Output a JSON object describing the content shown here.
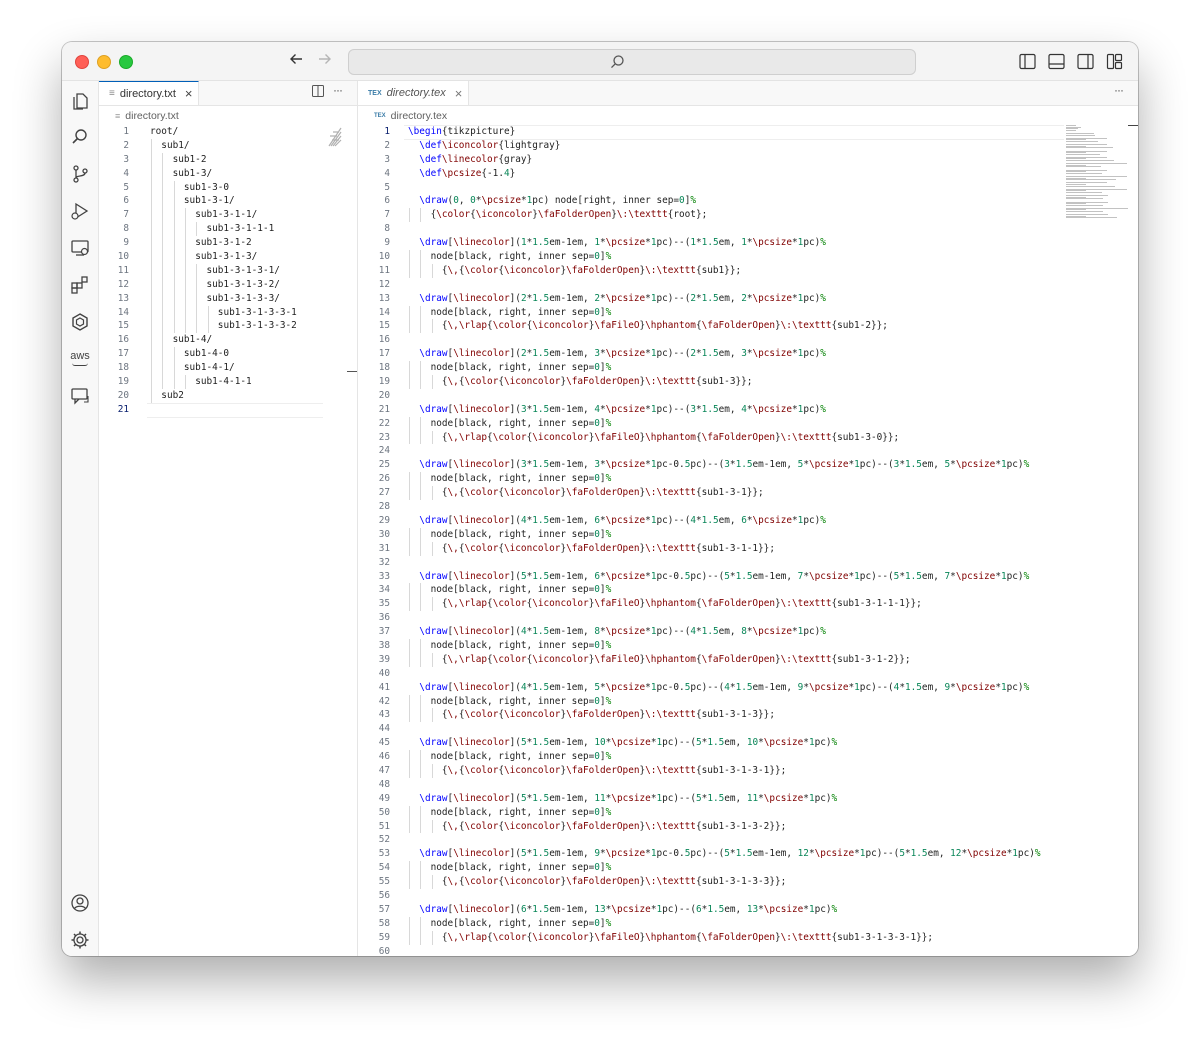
{
  "window": {
    "search_placeholder": "",
    "colors": {
      "accent": "#005fb8",
      "red": "#ff5f57",
      "yellow": "#febc2e",
      "green": "#28c840"
    }
  },
  "activity_bar": {
    "icons": [
      "explorer-icon",
      "search-icon",
      "source-control-icon",
      "run-debug-icon",
      "remote-explorer-icon",
      "extensions-icon",
      "hexagon-icon",
      "aws-icon",
      "chat-icon",
      "account-icon",
      "settings-gear-icon"
    ],
    "aws_label": "aws"
  },
  "left_editor": {
    "tab": {
      "name": "directory.txt",
      "close": "×"
    },
    "actions": [
      "split-editor-icon",
      "more-actions-icon"
    ],
    "more_label": "···",
    "breadcrumb": "directory.txt",
    "current_line": 21,
    "lines": [
      {
        "n": 1,
        "text": "root/"
      },
      {
        "n": 2,
        "text": "sub1/"
      },
      {
        "n": 3,
        "text": "sub1-2"
      },
      {
        "n": 4,
        "text": "sub1-3/"
      },
      {
        "n": 5,
        "text": "sub1-3-0"
      },
      {
        "n": 6,
        "text": "sub1-3-1/"
      },
      {
        "n": 7,
        "text": "sub1-3-1-1/"
      },
      {
        "n": 8,
        "text": "sub1-3-1-1-1"
      },
      {
        "n": 9,
        "text": "sub1-3-1-2"
      },
      {
        "n": 10,
        "text": "sub1-3-1-3/"
      },
      {
        "n": 11,
        "text": "sub1-3-1-3-1/"
      },
      {
        "n": 12,
        "text": "sub1-3-1-3-2/"
      },
      {
        "n": 13,
        "text": "sub1-3-1-3-3/"
      },
      {
        "n": 14,
        "text": "sub1-3-1-3-3-1"
      },
      {
        "n": 15,
        "text": "sub1-3-1-3-3-2"
      },
      {
        "n": 16,
        "text": "sub1-4/"
      },
      {
        "n": 17,
        "text": "sub1-4-0"
      },
      {
        "n": 18,
        "text": "sub1-4-1/"
      },
      {
        "n": 19,
        "text": "sub1-4-1-1"
      },
      {
        "n": 20,
        "text": "sub2"
      },
      {
        "n": 21,
        "text": ""
      }
    ]
  },
  "right_editor": {
    "tab": {
      "name": "directory.tex",
      "icon_label": "TEX",
      "close": "×"
    },
    "more_label": "···",
    "breadcrumb": "directory.tex",
    "current_line": 1,
    "lines": [
      {
        "n": 1,
        "text": "\\begin{tikzpicture}"
      },
      {
        "n": 2,
        "text": "  \\def\\iconcolor{lightgray}"
      },
      {
        "n": 3,
        "text": "  \\def\\linecolor{gray}"
      },
      {
        "n": 4,
        "text": "  \\def\\pcsize{-1.4}"
      },
      {
        "n": 5,
        "text": ""
      },
      {
        "n": 6,
        "text": "  \\draw(0, 0*\\pcsize*1pc) node[right, inner sep=0]%"
      },
      {
        "n": 7,
        "text": "    {\\color{\\iconcolor}\\faFolderOpen}\\:\\texttt{root};"
      },
      {
        "n": 8,
        "text": ""
      },
      {
        "n": 9,
        "text": "  \\draw[\\linecolor](1*1.5em-1em, 1*\\pcsize*1pc)--(1*1.5em, 1*\\pcsize*1pc)%"
      },
      {
        "n": 10,
        "text": "    node[black, right, inner sep=0]%"
      },
      {
        "n": 11,
        "text": "      {\\,{\\color{\\iconcolor}\\faFolderOpen}\\:\\texttt{sub1}};"
      },
      {
        "n": 12,
        "text": ""
      },
      {
        "n": 13,
        "text": "  \\draw[\\linecolor](2*1.5em-1em, 2*\\pcsize*1pc)--(2*1.5em, 2*\\pcsize*1pc)%"
      },
      {
        "n": 14,
        "text": "    node[black, right, inner sep=0]%"
      },
      {
        "n": 15,
        "text": "      {\\,\\rlap{\\color{\\iconcolor}\\faFileO}\\hphantom{\\faFolderOpen}\\:\\texttt{sub1-2}};"
      },
      {
        "n": 16,
        "text": ""
      },
      {
        "n": 17,
        "text": "  \\draw[\\linecolor](2*1.5em-1em, 3*\\pcsize*1pc)--(2*1.5em, 3*\\pcsize*1pc)%"
      },
      {
        "n": 18,
        "text": "    node[black, right, inner sep=0]%"
      },
      {
        "n": 19,
        "text": "      {\\,{\\color{\\iconcolor}\\faFolderOpen}\\:\\texttt{sub1-3}};"
      },
      {
        "n": 20,
        "text": ""
      },
      {
        "n": 21,
        "text": "  \\draw[\\linecolor](3*1.5em-1em, 4*\\pcsize*1pc)--(3*1.5em, 4*\\pcsize*1pc)%"
      },
      {
        "n": 22,
        "text": "    node[black, right, inner sep=0]%"
      },
      {
        "n": 23,
        "text": "      {\\,\\rlap{\\color{\\iconcolor}\\faFileO}\\hphantom{\\faFolderOpen}\\:\\texttt{sub1-3-0}};"
      },
      {
        "n": 24,
        "text": ""
      },
      {
        "n": 25,
        "text": "  \\draw[\\linecolor](3*1.5em-1em, 3*\\pcsize*1pc-0.5pc)--(3*1.5em-1em, 5*\\pcsize*1pc)--(3*1.5em, 5*\\pcsize*1pc)%"
      },
      {
        "n": 26,
        "text": "    node[black, right, inner sep=0]%"
      },
      {
        "n": 27,
        "text": "      {\\,{\\color{\\iconcolor}\\faFolderOpen}\\:\\texttt{sub1-3-1}};"
      },
      {
        "n": 28,
        "text": ""
      },
      {
        "n": 29,
        "text": "  \\draw[\\linecolor](4*1.5em-1em, 6*\\pcsize*1pc)--(4*1.5em, 6*\\pcsize*1pc)%"
      },
      {
        "n": 30,
        "text": "    node[black, right, inner sep=0]%"
      },
      {
        "n": 31,
        "text": "      {\\,{\\color{\\iconcolor}\\faFolderOpen}\\:\\texttt{sub1-3-1-1}};"
      },
      {
        "n": 32,
        "text": ""
      },
      {
        "n": 33,
        "text": "  \\draw[\\linecolor](5*1.5em-1em, 6*\\pcsize*1pc-0.5pc)--(5*1.5em-1em, 7*\\pcsize*1pc)--(5*1.5em, 7*\\pcsize*1pc)%"
      },
      {
        "n": 34,
        "text": "    node[black, right, inner sep=0]%"
      },
      {
        "n": 35,
        "text": "      {\\,\\rlap{\\color{\\iconcolor}\\faFileO}\\hphantom{\\faFolderOpen}\\:\\texttt{sub1-3-1-1-1}};"
      },
      {
        "n": 36,
        "text": ""
      },
      {
        "n": 37,
        "text": "  \\draw[\\linecolor](4*1.5em-1em, 8*\\pcsize*1pc)--(4*1.5em, 8*\\pcsize*1pc)%"
      },
      {
        "n": 38,
        "text": "    node[black, right, inner sep=0]%"
      },
      {
        "n": 39,
        "text": "      {\\,\\rlap{\\color{\\iconcolor}\\faFileO}\\hphantom{\\faFolderOpen}\\:\\texttt{sub1-3-1-2}};"
      },
      {
        "n": 40,
        "text": ""
      },
      {
        "n": 41,
        "text": "  \\draw[\\linecolor](4*1.5em-1em, 5*\\pcsize*1pc-0.5pc)--(4*1.5em-1em, 9*\\pcsize*1pc)--(4*1.5em, 9*\\pcsize*1pc)%"
      },
      {
        "n": 42,
        "text": "    node[black, right, inner sep=0]%"
      },
      {
        "n": 43,
        "text": "      {\\,{\\color{\\iconcolor}\\faFolderOpen}\\:\\texttt{sub1-3-1-3}};"
      },
      {
        "n": 44,
        "text": ""
      },
      {
        "n": 45,
        "text": "  \\draw[\\linecolor](5*1.5em-1em, 10*\\pcsize*1pc)--(5*1.5em, 10*\\pcsize*1pc)%"
      },
      {
        "n": 46,
        "text": "    node[black, right, inner sep=0]%"
      },
      {
        "n": 47,
        "text": "      {\\,{\\color{\\iconcolor}\\faFolderOpen}\\:\\texttt{sub1-3-1-3-1}};"
      },
      {
        "n": 48,
        "text": ""
      },
      {
        "n": 49,
        "text": "  \\draw[\\linecolor](5*1.5em-1em, 11*\\pcsize*1pc)--(5*1.5em, 11*\\pcsize*1pc)%"
      },
      {
        "n": 50,
        "text": "    node[black, right, inner sep=0]%"
      },
      {
        "n": 51,
        "text": "      {\\,{\\color{\\iconcolor}\\faFolderOpen}\\:\\texttt{sub1-3-1-3-2}};"
      },
      {
        "n": 52,
        "text": ""
      },
      {
        "n": 53,
        "text": "  \\draw[\\linecolor](5*1.5em-1em, 9*\\pcsize*1pc-0.5pc)--(5*1.5em-1em, 12*\\pcsize*1pc)--(5*1.5em, 12*\\pcsize*1pc)%"
      },
      {
        "n": 54,
        "text": "    node[black, right, inner sep=0]%"
      },
      {
        "n": 55,
        "text": "      {\\,{\\color{\\iconcolor}\\faFolderOpen}\\:\\texttt{sub1-3-1-3-3}};"
      },
      {
        "n": 56,
        "text": ""
      },
      {
        "n": 57,
        "text": "  \\draw[\\linecolor](6*1.5em-1em, 13*\\pcsize*1pc)--(6*1.5em, 13*\\pcsize*1pc)%"
      },
      {
        "n": 58,
        "text": "    node[black, right, inner sep=0]%"
      },
      {
        "n": 59,
        "text": "      {\\,\\rlap{\\color{\\iconcolor}\\faFileO}\\hphantom{\\faFolderOpen}\\:\\texttt{sub1-3-1-3-3-1}};"
      },
      {
        "n": 60,
        "text": ""
      }
    ]
  }
}
